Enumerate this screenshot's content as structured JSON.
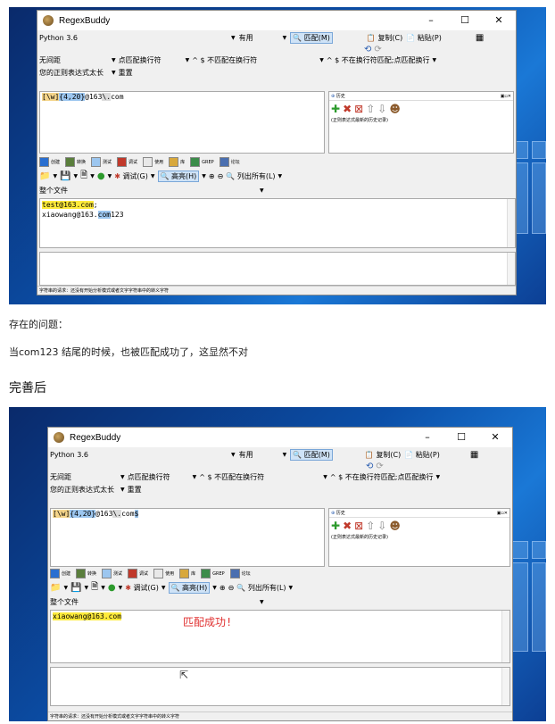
{
  "common": {
    "app_title": "RegexBuddy",
    "win_min": "–",
    "win_max": "☐",
    "win_close": "✕",
    "flavor": "Python 3.6",
    "use_mode": "有用",
    "match_btn": "匹配(M)",
    "copy_btn": "复制(C)",
    "paste_btn": "粘贴(P)",
    "opt_free_spacing": "无间距",
    "opt_dot": "点匹配换行符",
    "opt_caret1": "^ $ 不匹配在换行符",
    "opt_caret2": "^ $ 不在换行符匹配;点匹配换行",
    "opt_too_long": "您的正则表达式太长",
    "opt_reset": "重置",
    "history_title": "历史",
    "history_sub": "(正则表达式最新的历史记录)",
    "tool_tabs": [
      "创建",
      "转换",
      "测试",
      "调试",
      "使用",
      "库",
      "GREP",
      "论坛"
    ],
    "debug_btn": "调试(G)",
    "highlight_btn": "高亮(H)",
    "list_all_btn": "列出所有(L)",
    "whole_file": "整个文件",
    "status": "字符串的请求：还没有开始分析模式或者文字字符串中的转义字符"
  },
  "shot1": {
    "regex": {
      "p1": "[\\w]",
      "p2": "{4,20}",
      "p3": "@163",
      "p4": "\\.",
      "p5": "com"
    },
    "test_line1_match": "test@163.com",
    "test_line1_tail": ";",
    "test_line2_pre": "xiaowang@163.",
    "test_line2_match": "com",
    "test_line2_tail": "123"
  },
  "caption_problem": "存在的问题：",
  "caption_desc": "当com123 结尾的时候，也被匹配成功了，这显然不对",
  "caption_improved": "完善后",
  "shot2": {
    "regex": {
      "p1": "[\\w]",
      "p2": "{4,20}",
      "p3": "@163",
      "p4": "\\.",
      "p5": "com",
      "p6": "$"
    },
    "test_line1": "xiaowang@163.com",
    "note": "匹配成功!"
  }
}
